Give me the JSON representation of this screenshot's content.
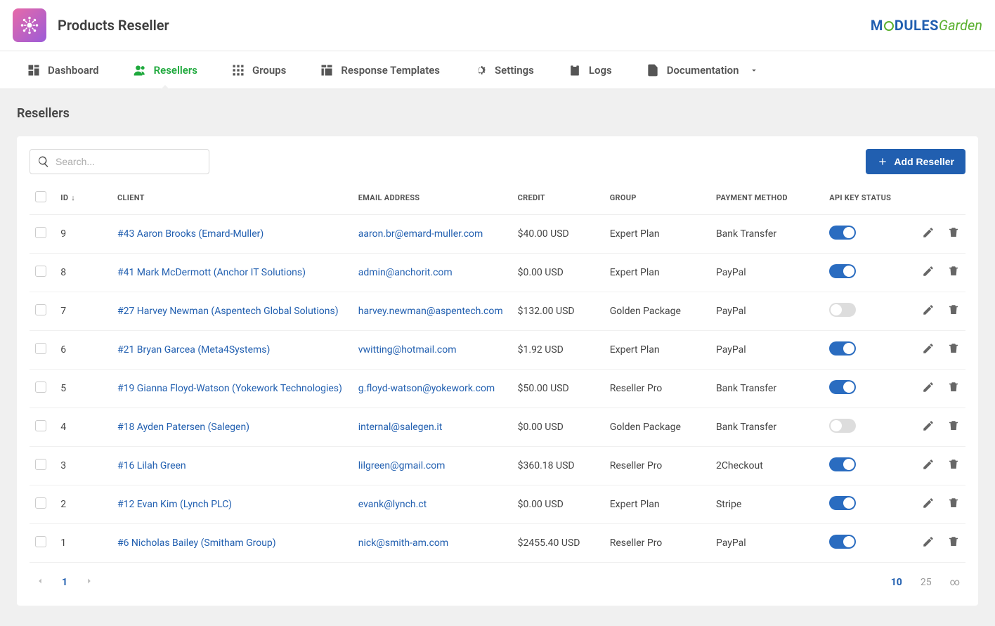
{
  "header": {
    "title": "Products Reseller"
  },
  "nav": {
    "dashboard": "Dashboard",
    "resellers": "Resellers",
    "groups": "Groups",
    "response_templates": "Response Templates",
    "settings": "Settings",
    "logs": "Logs",
    "documentation": "Documentation"
  },
  "page": {
    "title": "Resellers"
  },
  "search": {
    "placeholder": "Search..."
  },
  "buttons": {
    "add_reseller": "Add Reseller"
  },
  "columns": {
    "id": "ID",
    "client": "CLIENT",
    "email": "EMAIL ADDRESS",
    "credit": "CREDIT",
    "group": "GROUP",
    "payment": "PAYMENT METHOD",
    "api": "API KEY STATUS"
  },
  "rows": [
    {
      "id": "9",
      "client": "#43 Aaron Brooks (Emard-Muller)",
      "email": "aaron.br@emard-muller.com",
      "credit": "$40.00 USD",
      "group": "Expert Plan",
      "payment": "Bank Transfer",
      "api": true
    },
    {
      "id": "8",
      "client": "#41 Mark McDermott (Anchor IT Solutions)",
      "email": "admin@anchorit.com",
      "credit": "$0.00 USD",
      "group": "Expert Plan",
      "payment": "PayPal",
      "api": true
    },
    {
      "id": "7",
      "client": "#27 Harvey Newman (Aspentech Global Solutions)",
      "email": "harvey.newman@aspentech.com",
      "credit": "$132.00 USD",
      "group": "Golden Package",
      "payment": "PayPal",
      "api": false
    },
    {
      "id": "6",
      "client": "#21 Bryan Garcea (Meta4Systems)",
      "email": "vwitting@hotmail.com",
      "credit": "$1.92 USD",
      "group": "Expert Plan",
      "payment": "PayPal",
      "api": true
    },
    {
      "id": "5",
      "client": "#19 Gianna Floyd-Watson (Yokework Technologies)",
      "email": "g.floyd-watson@yokework.com",
      "credit": "$50.00 USD",
      "group": "Reseller Pro",
      "payment": "Bank Transfer",
      "api": true
    },
    {
      "id": "4",
      "client": "#18 Ayden Patersen (Salegen)",
      "email": "internal@salegen.it",
      "credit": "$0.00 USD",
      "group": "Golden Package",
      "payment": "Bank Transfer",
      "api": false
    },
    {
      "id": "3",
      "client": "#16 Lilah Green",
      "email": "lilgreen@gmail.com",
      "credit": "$360.18 USD",
      "group": "Reseller Pro",
      "payment": "2Checkout",
      "api": true
    },
    {
      "id": "2",
      "client": "#12 Evan Kim (Lynch PLC)",
      "email": "evank@lynch.ct",
      "credit": "$0.00 USD",
      "group": "Expert Plan",
      "payment": "Stripe",
      "api": true
    },
    {
      "id": "1",
      "client": "#6 Nicholas Bailey (Smitham Group)",
      "email": "nick@smith-am.com",
      "credit": "$2455.40 USD",
      "group": "Reseller Pro",
      "payment": "PayPal",
      "api": true
    }
  ],
  "pagination": {
    "current": "1"
  },
  "per_page": {
    "p10": "10",
    "p25": "25",
    "inf": "∞"
  }
}
